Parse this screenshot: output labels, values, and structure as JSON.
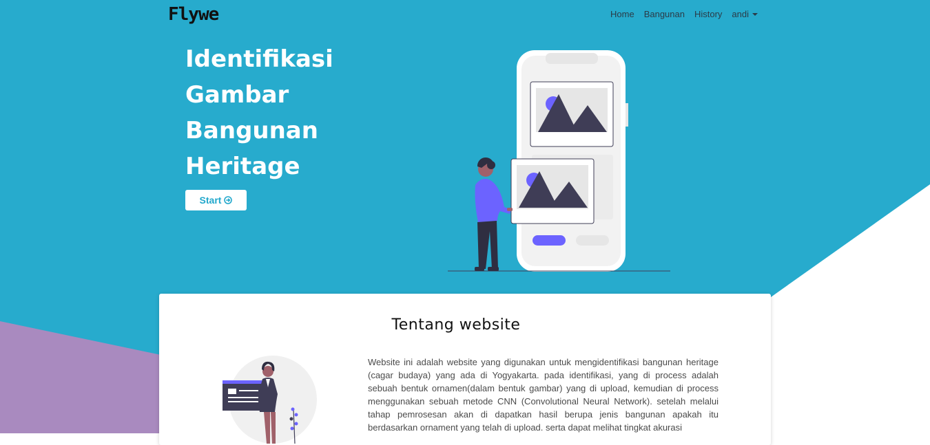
{
  "navbar": {
    "brand": "Flywe",
    "items": [
      {
        "label": "Home"
      },
      {
        "label": "Bangunan"
      },
      {
        "label": "History"
      }
    ],
    "user_label": "andi"
  },
  "hero": {
    "title_lines": [
      "Identifikasi",
      "Gambar",
      "Bangunan",
      "Heritage"
    ],
    "start_label": "Start",
    "start_icon": "arrow-circle-right-icon"
  },
  "about": {
    "title": "Tentang website",
    "text": "Website ini adalah website yang digunakan untuk mengidentifikasi bangunan heritage (cagar budaya) yang ada di Yogyakarta. pada identifikasi, yang di process adalah sebuah bentuk ornamen(dalam bentuk gambar) yang di upload, kemudian di process menggunakan sebuah metode CNN (Convolutional Neural Network). setelah melalui tahap pemrosesan akan di dapatkan hasil berupa jenis bangunan apakah itu berdasarkan ornament yang telah di upload. serta dapat melihat tingkat akurasi"
  },
  "colors": {
    "primary": "#27abcd",
    "accent_purple": "#a98abf",
    "illustration_purple": "#6c63ff",
    "dark": "#3f3d56"
  }
}
